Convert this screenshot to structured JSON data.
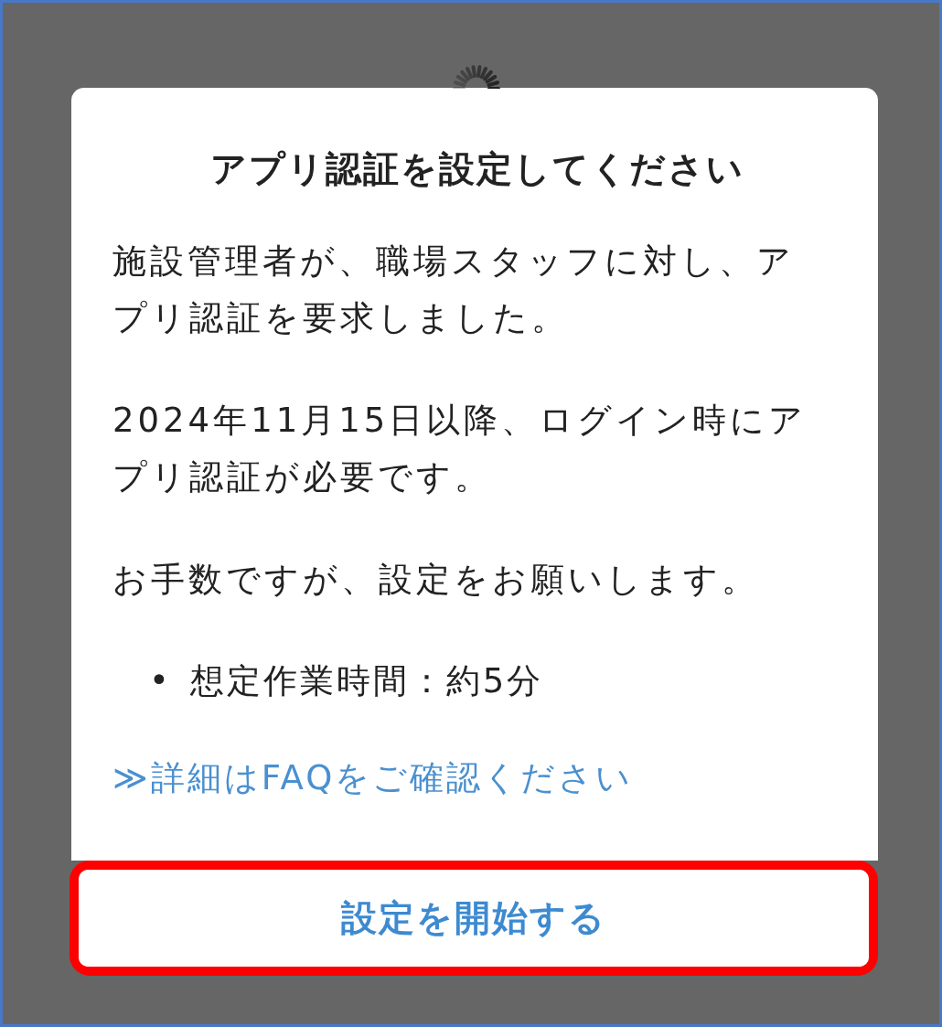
{
  "dialog": {
    "title": "アプリ認証を設定してください",
    "paragraphs": [
      "施設管理者が、職場スタッフに対し、アプリ認証を要求しました。",
      "2024年11月15日以降、ログイン時にアプリ認証が必要です。",
      "お手数ですが、設定をお願いします。"
    ],
    "bullets": [
      {
        "marker": "•",
        "text": "想定作業時間：約5分"
      }
    ],
    "link": "≫詳細はFAQをご確認ください",
    "button": {
      "label": "設定を開始する",
      "highlighted": true
    }
  }
}
